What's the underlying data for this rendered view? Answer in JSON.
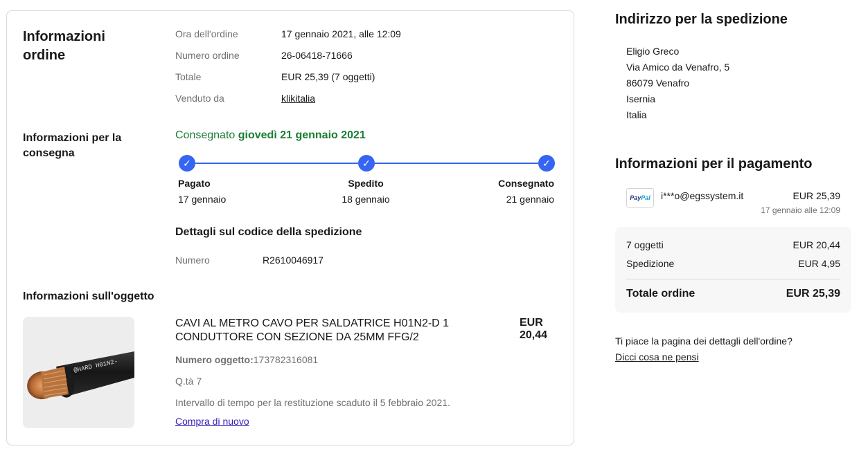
{
  "order_info": {
    "title": "Informazioni ordine",
    "rows": [
      {
        "label": "Ora dell'ordine",
        "value": "17 gennaio 2021, alle 12:09"
      },
      {
        "label": "Numero ordine",
        "value": "26-06418-71666"
      },
      {
        "label": "Totale",
        "value": "EUR 25,39 (7 oggetti)"
      },
      {
        "label": "Venduto da",
        "value": "klikitalia"
      }
    ]
  },
  "delivery": {
    "title": "Informazioni per la consegna",
    "status_prefix": "Consegnato",
    "status_date": "giovedì 21 gennaio 2021",
    "steps": [
      {
        "label": "Pagato",
        "date": "17 gennaio"
      },
      {
        "label": "Spedito",
        "date": "18 gennaio"
      },
      {
        "label": "Consegnato",
        "date": "21 gennaio"
      }
    ],
    "tracking_title": "Dettagli sul codice della spedizione",
    "tracking_label": "Numero",
    "tracking_number": "R2610046917"
  },
  "item": {
    "section_title": "Informazioni sull'oggetto",
    "title": "CAVI AL METRO CAVO PER SALDATRICE H01N2-D 1 CONDUTTORE CON SEZIONE DA 25MM FFG/2",
    "price_currency": "EUR",
    "price_value": "20,44",
    "item_number_label": "Numero oggetto:",
    "item_number": "173782316081",
    "quantity": "Q.tà 7",
    "return_note": "Intervallo di tempo per la restituzione scaduto il 5 febbraio 2021.",
    "buy_again": "Compra di nuovo",
    "image_text": "@HARD H01N2-"
  },
  "shipping": {
    "title": "Indirizzo per la spedizione",
    "lines": [
      "Eligio Greco",
      "Via Amico da Venafro, 5",
      "86079 Venafro",
      "Isernia",
      "Italia"
    ]
  },
  "payment": {
    "title": "Informazioni per il pagamento",
    "logo_part1": "Pay",
    "logo_part2": "Pal",
    "account": "i***o@egssystem.it",
    "amount": "EUR 25,39",
    "date": "17 gennaio alle 12:09",
    "summary": {
      "items_label": "7 oggetti",
      "items_value": "EUR 20,44",
      "shipping_label": "Spedizione",
      "shipping_value": "EUR 4,95",
      "total_label": "Totale ordine",
      "total_value": "EUR 25,39"
    }
  },
  "feedback": {
    "question": "Ti piace la pagina dei dettagli dell'ordine?",
    "link": "Dicci cosa ne pensi"
  },
  "colors": {
    "accent_blue": "#3665f3",
    "status_green": "#1b7d35",
    "label_gray": "#707070"
  }
}
